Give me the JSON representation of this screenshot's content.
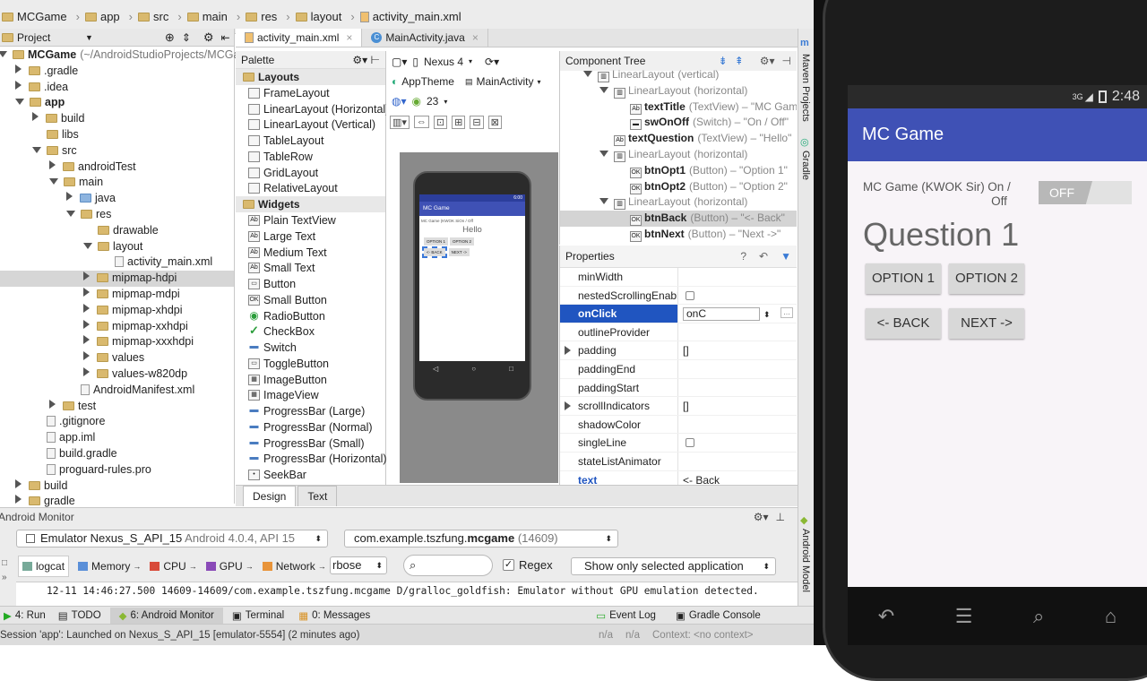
{
  "breadcrumbs": [
    "MCGame",
    "app",
    "src",
    "main",
    "res",
    "layout",
    "activity_main.xml"
  ],
  "project": {
    "header": "Project",
    "tree": [
      {
        "label": "MCGame",
        "extra": "(~/AndroidStudioProjects/MCGam",
        "depth": 0,
        "arrow": "down",
        "icon": "folder",
        "bold": true
      },
      {
        "label": ".gradle",
        "depth": 1,
        "arrow": "right",
        "icon": "folder"
      },
      {
        "label": ".idea",
        "depth": 1,
        "arrow": "right",
        "icon": "folder"
      },
      {
        "label": "app",
        "depth": 1,
        "arrow": "down",
        "icon": "folder",
        "bold": true
      },
      {
        "label": "build",
        "depth": 2,
        "arrow": "right",
        "icon": "folder"
      },
      {
        "label": "libs",
        "depth": 2,
        "arrow": "",
        "icon": "folder"
      },
      {
        "label": "src",
        "depth": 2,
        "arrow": "down",
        "icon": "folder"
      },
      {
        "label": "androidTest",
        "depth": 3,
        "arrow": "right",
        "icon": "folder"
      },
      {
        "label": "main",
        "depth": 3,
        "arrow": "down",
        "icon": "folder"
      },
      {
        "label": "java",
        "depth": 4,
        "arrow": "right",
        "icon": "folder-blue"
      },
      {
        "label": "res",
        "depth": 4,
        "arrow": "down",
        "icon": "folder"
      },
      {
        "label": "drawable",
        "depth": 5,
        "arrow": "",
        "icon": "folder"
      },
      {
        "label": "layout",
        "depth": 5,
        "arrow": "down",
        "icon": "folder"
      },
      {
        "label": "activity_main.xml",
        "depth": 6,
        "arrow": "",
        "icon": "file"
      },
      {
        "label": "mipmap-hdpi",
        "depth": 5,
        "arrow": "right",
        "icon": "folder",
        "selected": true
      },
      {
        "label": "mipmap-mdpi",
        "depth": 5,
        "arrow": "right",
        "icon": "folder"
      },
      {
        "label": "mipmap-xhdpi",
        "depth": 5,
        "arrow": "right",
        "icon": "folder"
      },
      {
        "label": "mipmap-xxhdpi",
        "depth": 5,
        "arrow": "right",
        "icon": "folder"
      },
      {
        "label": "mipmap-xxxhdpi",
        "depth": 5,
        "arrow": "right",
        "icon": "folder"
      },
      {
        "label": "values",
        "depth": 5,
        "arrow": "right",
        "icon": "folder"
      },
      {
        "label": "values-w820dp",
        "depth": 5,
        "arrow": "right",
        "icon": "folder"
      },
      {
        "label": "AndroidManifest.xml",
        "depth": 4,
        "arrow": "",
        "icon": "file"
      },
      {
        "label": "test",
        "depth": 3,
        "arrow": "right",
        "icon": "folder"
      },
      {
        "label": ".gitignore",
        "depth": 2,
        "arrow": "",
        "icon": "file"
      },
      {
        "label": "app.iml",
        "depth": 2,
        "arrow": "",
        "icon": "file"
      },
      {
        "label": "build.gradle",
        "depth": 2,
        "arrow": "",
        "icon": "file"
      },
      {
        "label": "proguard-rules.pro",
        "depth": 2,
        "arrow": "",
        "icon": "file"
      },
      {
        "label": "build",
        "depth": 1,
        "arrow": "right",
        "icon": "folder"
      },
      {
        "label": "gradle",
        "depth": 1,
        "arrow": "right",
        "icon": "folder"
      }
    ]
  },
  "editor_tabs": [
    "activity_main.xml",
    "MainActivity.java"
  ],
  "palette": {
    "title": "Palette",
    "sections": [
      {
        "name": "Layouts",
        "items": [
          "FrameLayout",
          "LinearLayout (Horizontal)",
          "LinearLayout (Vertical)",
          "TableLayout",
          "TableRow",
          "GridLayout",
          "RelativeLayout"
        ]
      },
      {
        "name": "Widgets",
        "items": [
          "Plain TextView",
          "Large Text",
          "Medium Text",
          "Small Text",
          "Button",
          "Small Button",
          "RadioButton",
          "CheckBox",
          "Switch",
          "ToggleButton",
          "ImageButton",
          "ImageView",
          "ProgressBar (Large)",
          "ProgressBar (Normal)",
          "ProgressBar (Small)",
          "ProgressBar (Horizontal)",
          "SeekBar"
        ]
      }
    ]
  },
  "designer": {
    "device": "Nexus 4",
    "theme": "AppTheme",
    "activity": "MainActivity",
    "api": "23",
    "preview_title": "MC Game",
    "preview_time": "6:00",
    "preview_label": "MC Game (KWOK Si",
    "preview_switch": "On / Off",
    "preview_hello": "Hello",
    "preview_opt1": "OPTION 1",
    "preview_opt2": "OPTION 2",
    "preview_back": "<- BACK",
    "preview_next": "NEXT ->"
  },
  "component_tree": {
    "title": "Component Tree",
    "rows": [
      {
        "depth": 1,
        "arrow": "down",
        "name": "LinearLayout",
        "detail": "(vertical)",
        "grey": true
      },
      {
        "depth": 2,
        "arrow": "down",
        "name": "LinearLayout",
        "detail": "(horizontal)",
        "grey": true
      },
      {
        "depth": 3,
        "arrow": "",
        "name": "textTitle",
        "detail": "(TextView) – \"MC Gam"
      },
      {
        "depth": 3,
        "arrow": "",
        "name": "swOnOff",
        "detail": "(Switch) – \"On / Off\""
      },
      {
        "depth": 2,
        "arrow": "",
        "name": "textQuestion",
        "detail": "(TextView) – \"Hello\""
      },
      {
        "depth": 2,
        "arrow": "down",
        "name": "LinearLayout",
        "detail": "(horizontal)",
        "grey": true
      },
      {
        "depth": 3,
        "arrow": "",
        "name": "btnOpt1",
        "detail": "(Button) – \"Option 1\""
      },
      {
        "depth": 3,
        "arrow": "",
        "name": "btnOpt2",
        "detail": "(Button) – \"Option 2\""
      },
      {
        "depth": 2,
        "arrow": "down",
        "name": "LinearLayout",
        "detail": "(horizontal)",
        "grey": true
      },
      {
        "depth": 3,
        "arrow": "",
        "name": "btnBack",
        "detail": "(Button) – \"<- Back\"",
        "selected": true
      },
      {
        "depth": 3,
        "arrow": "",
        "name": "btnNext",
        "detail": "(Button) – \"Next ->\""
      }
    ]
  },
  "properties": {
    "title": "Properties",
    "rows": [
      {
        "name": "minWidth",
        "value": "",
        "type": "text"
      },
      {
        "name": "nestedScrollingEnable",
        "value": "",
        "type": "checkbox"
      },
      {
        "name": "onClick",
        "value": "onC",
        "type": "combo",
        "selected": true
      },
      {
        "name": "outlineProvider",
        "value": "",
        "type": "text"
      },
      {
        "name": "padding",
        "value": "[]",
        "type": "text",
        "expand": true
      },
      {
        "name": "paddingEnd",
        "value": "",
        "type": "text"
      },
      {
        "name": "paddingStart",
        "value": "",
        "type": "text"
      },
      {
        "name": "scrollIndicators",
        "value": "[]",
        "type": "text",
        "expand": true
      },
      {
        "name": "shadowColor",
        "value": "",
        "type": "text"
      },
      {
        "name": "singleLine",
        "value": "",
        "type": "checkbox"
      },
      {
        "name": "stateListAnimator",
        "value": "",
        "type": "text"
      },
      {
        "name": "text",
        "value": "<- Back",
        "type": "text"
      }
    ]
  },
  "gutter": {
    "maven": "Maven Projects",
    "gradle": "Gradle",
    "monitor": "Android Model"
  },
  "design_tabs": [
    "Design",
    "Text"
  ],
  "monitor": {
    "title": "Android Monitor",
    "device": "Emulator Nexus_S_API_15",
    "device_info": "Android 4.0.4, API 15",
    "process_prefix": "com.example.tszfung.",
    "process_bold": "mcgame",
    "process_pid": "(14609)",
    "tabs": [
      "logcat",
      "Memory",
      "CPU",
      "GPU",
      "Network"
    ],
    "verbosity": "rbose",
    "search_placeholder": "",
    "regex_label": "Regex",
    "filter": "Show only selected application",
    "log_line": "12-11 14:46:27.500 14609-14609/com.example.tszfung.mcgame D/gralloc_goldfish: Emulator without GPU emulation detected."
  },
  "statusbar": {
    "run": "4: Run",
    "todo": "TODO",
    "monitor": "6: Android Monitor",
    "terminal": "Terminal",
    "messages": "0: Messages",
    "eventlog": "Event Log",
    "gradle_console": "Gradle Console"
  },
  "infobar": {
    "message": "Session 'app': Launched on Nexus_S_API_15 [emulator-5554] (2 minutes ago)",
    "na1": "n/a",
    "na2": "n/a",
    "context": "Context: <no context>"
  },
  "emulator": {
    "status_3g": "3G",
    "time": "2:48",
    "app_title": "MC Game",
    "label": "MC Game (KWOK Sir)",
    "switch_label": "On / Off",
    "switch_state": "OFF",
    "question": "Question 1",
    "opt1": "OPTION 1",
    "opt2": "OPTION 2",
    "back": "<- BACK",
    "next": "NEXT ->"
  },
  "colors": {
    "accent": "#3f51b5",
    "selection": "#2055c0"
  }
}
